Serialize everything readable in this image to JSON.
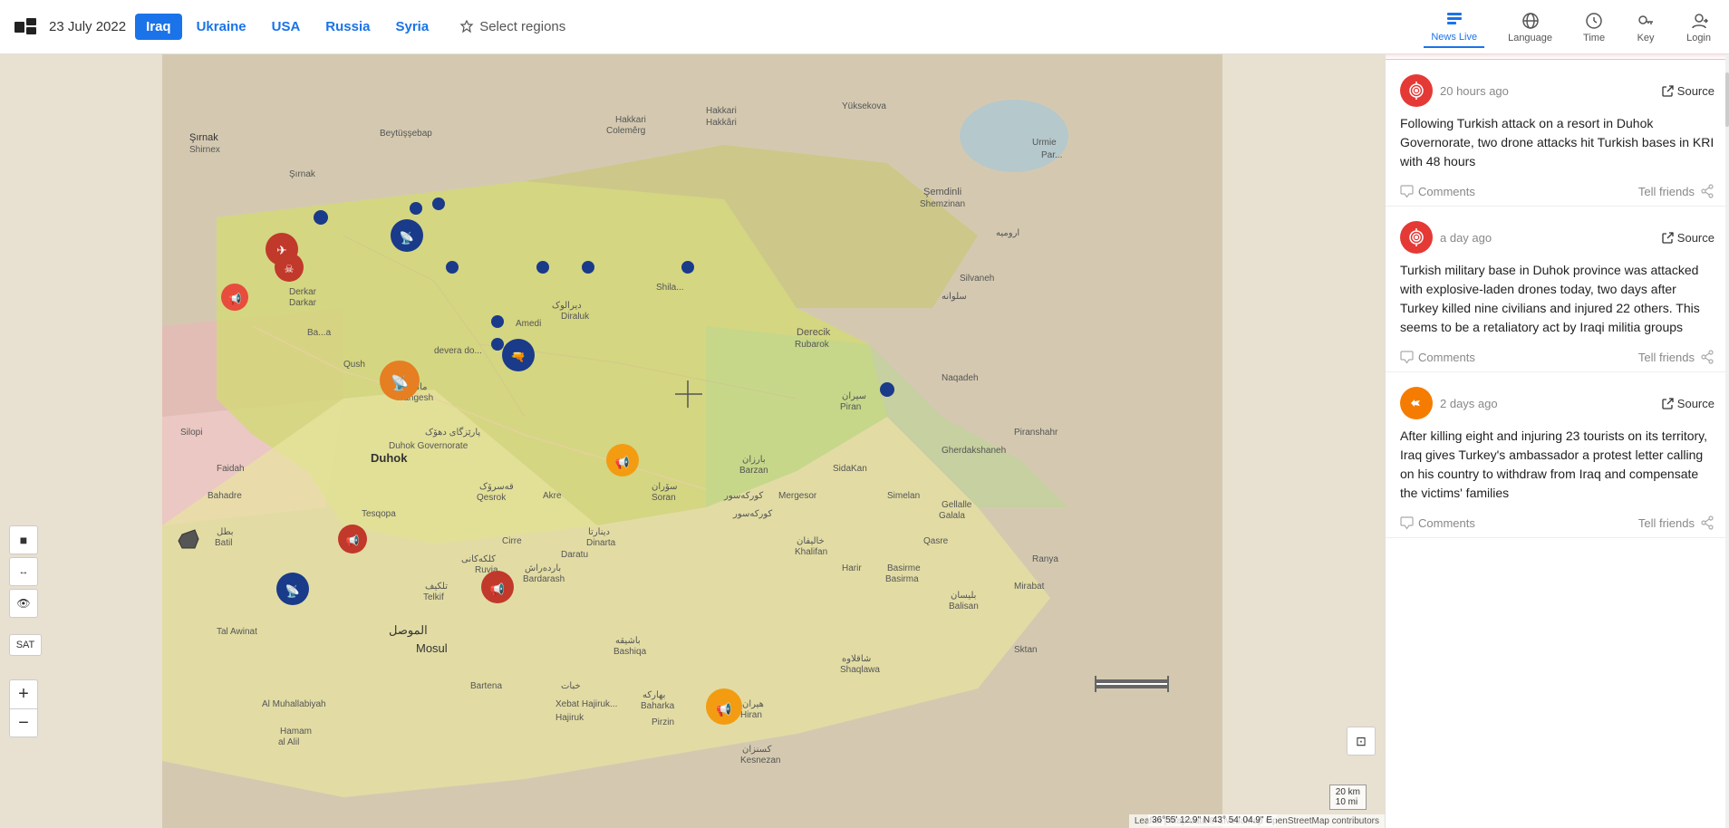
{
  "header": {
    "date": "23 July 2022",
    "logo_alt": "LiveuaMap logo",
    "nav_links": [
      {
        "label": "Iraq",
        "active": true
      },
      {
        "label": "Ukraine",
        "active": false
      },
      {
        "label": "USA",
        "active": false
      },
      {
        "label": "Russia",
        "active": false
      },
      {
        "label": "Syria",
        "active": false
      }
    ],
    "select_regions": "Select regions",
    "nav_icons": [
      {
        "label": "News Live",
        "active": true
      },
      {
        "label": "Language",
        "active": false
      },
      {
        "label": "Time",
        "active": false
      },
      {
        "label": "Key",
        "active": false
      },
      {
        "label": "Login",
        "active": false
      }
    ]
  },
  "map": {
    "attribution": "Leaflet | Map data © LiveuaMap OpenStreetMap contributors",
    "scale_km": "20 km",
    "scale_mi": "10 mi",
    "coords": "36°55' 12.9\" N 43° 54' 04.9\" E"
  },
  "sidebar": {
    "items": [
      {
        "icon_type": "red",
        "time": "20 hours ago",
        "source_label": "Source",
        "body": "Following Turkish attack on a resort in Duhok Governorate, two drone attacks hit Turkish bases in KRI with 48 hours",
        "comments_label": "Comments",
        "share_label": "Tell friends"
      },
      {
        "icon_type": "red",
        "time": "a day ago",
        "source_label": "Source",
        "body": "Turkish military base in Duhok province was attacked with explosive-laden drones today, two days after Turkey killed nine civilians and injured 22 others. This seems to be a retaliatory act by Iraqi militia groups",
        "comments_label": "Comments",
        "share_label": "Tell friends"
      },
      {
        "icon_type": "orange",
        "time": "2 days ago",
        "source_label": "Source",
        "body": "After killing eight and injuring 23 tourists on its territory, Iraq gives Turkey's ambassador a protest letter calling on his country to withdraw from Iraq and compensate the victims' families",
        "comments_label": "Comments",
        "share_label": "Tell friends"
      }
    ]
  },
  "map_controls": {
    "zoom_in": "+",
    "zoom_out": "−",
    "sat_label": "SAT"
  }
}
